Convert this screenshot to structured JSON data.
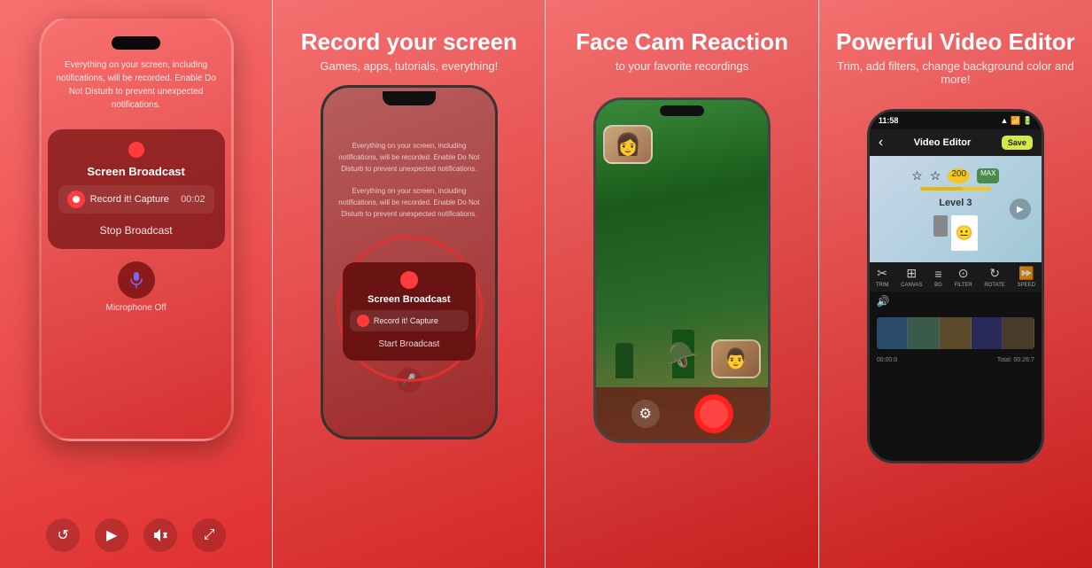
{
  "panels": [
    {
      "id": "panel-1",
      "bg": "#e84040",
      "phone_info": "Everything on your screen, including notifications, will be recorded. Enable Do Not Disturb to prevent unexpected notifications.",
      "broadcast_card": {
        "screen_broadcast_label": "Screen Broadcast",
        "record_label": "Record it! Capture",
        "timer": "00:02",
        "stop_label": "Stop Broadcast"
      },
      "mic_label": "Microphone\nOff",
      "bottom_icons": [
        "↺",
        "▶",
        "🔇",
        "⤢"
      ]
    },
    {
      "id": "panel-2",
      "title": "Record your screen",
      "subtitle": "Games, apps, tutorials, everything!",
      "popup": {
        "title": "Screen Broadcast",
        "row_label": "Record it! Capture",
        "start_label": "Start Broadcast"
      }
    },
    {
      "id": "panel-3",
      "title": "Face Cam Reaction",
      "subtitle": "to your favorite recordings"
    },
    {
      "id": "panel-4",
      "title": "Powerful Video Editor",
      "subtitle": "Trim, add filters, change background color and more!",
      "editor": {
        "time": "11:58",
        "title": "Video Editor",
        "save": "Save",
        "level": "Level 3",
        "tools": [
          "TRIM",
          "CANVAS",
          "BG",
          "FILTER",
          "ROTATE",
          "SPEED"
        ]
      }
    }
  ]
}
